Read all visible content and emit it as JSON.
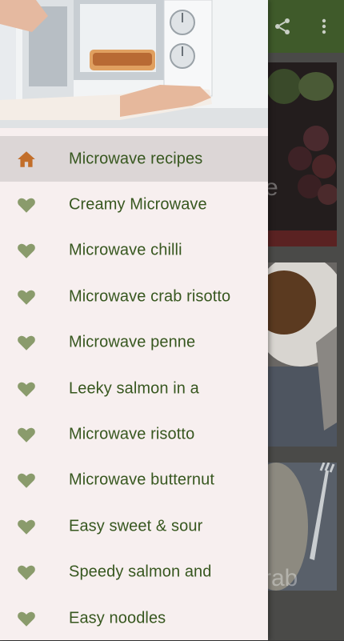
{
  "colors": {
    "toolbar": "#3f5a2a",
    "label_text": "#37571f",
    "heart_icon": "#8a9b6c",
    "home_icon": "#c26e2a",
    "drawer_bg": "#f7efef",
    "active_bg": "#dcd6d6"
  },
  "toolbar": {
    "icons": [
      "share-icon",
      "more-vert-icon"
    ]
  },
  "background_cards": {
    "card1_overlay_text": "e",
    "card3_overlay_text": "rab"
  },
  "drawer": {
    "header_image": "microwave-oven-photo",
    "items": [
      {
        "label": "Microwave recipes",
        "icon": "home-icon",
        "active": true
      },
      {
        "label": "Creamy Microwave",
        "icon": "heart-icon"
      },
      {
        "label": "Microwave chilli",
        "icon": "heart-icon"
      },
      {
        "label": "Microwave crab risotto",
        "icon": "heart-icon"
      },
      {
        "label": "Microwave penne",
        "icon": "heart-icon"
      },
      {
        "label": "Leeky salmon in a",
        "icon": "heart-icon"
      },
      {
        "label": "Microwave risotto",
        "icon": "heart-icon"
      },
      {
        "label": "Microwave butternut",
        "icon": "heart-icon"
      },
      {
        "label": "Easy sweet & sour",
        "icon": "heart-icon"
      },
      {
        "label": "Speedy salmon and",
        "icon": "heart-icon"
      },
      {
        "label": "Easy noodles",
        "icon": "heart-icon"
      }
    ]
  }
}
